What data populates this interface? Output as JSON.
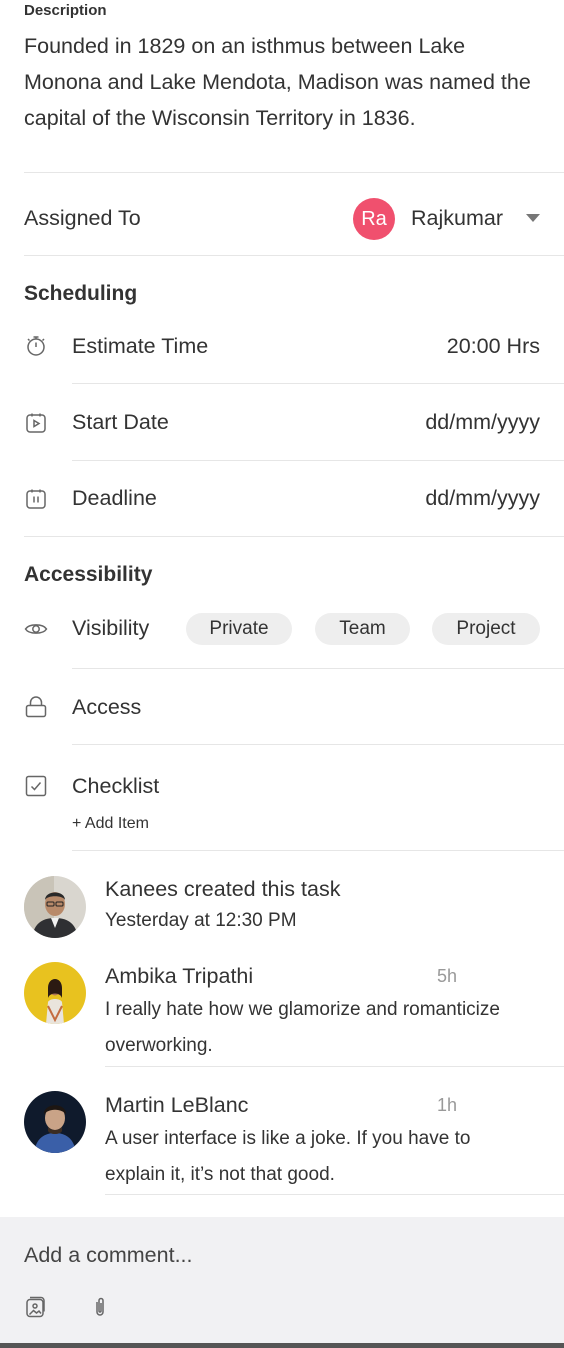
{
  "description": {
    "label": "Description",
    "text": "Founded in 1829 on an isthmus between Lake Monona and Lake Mendota, Madison was named the capital of the Wisconsin Territory in 1836."
  },
  "assigned": {
    "label": "Assigned To",
    "avatar_initials": "Ra",
    "avatar_color": "#f0506e",
    "name": "Rajkumar"
  },
  "scheduling": {
    "title": "Scheduling",
    "estimate": {
      "label": "Estimate Time",
      "value": "20:00 Hrs",
      "icon": "stopwatch-icon"
    },
    "start": {
      "label": "Start Date",
      "value": "dd/mm/yyyy",
      "icon": "calendar-play-icon"
    },
    "deadline": {
      "label": "Deadline",
      "value": "dd/mm/yyyy",
      "icon": "calendar-pause-icon"
    }
  },
  "accessibility": {
    "title": "Accessibility",
    "visibility": {
      "label": "Visibility",
      "icon": "eye-icon",
      "options": [
        "Private",
        "Team",
        "Project"
      ]
    },
    "access": {
      "label": "Access",
      "icon": "lock-icon"
    },
    "checklist": {
      "label": "Checklist",
      "icon": "checkbox-icon",
      "add_item": "+ Add Item"
    }
  },
  "activity": [
    {
      "name": "Kanees created this task",
      "sub": "Yesterday at 12:30 PM"
    },
    {
      "name": "Ambika Tripathi",
      "time": "5h",
      "text": "I really hate how we glamorize and romanticize overworking."
    },
    {
      "name": "Martin LeBlanc",
      "time": "1h",
      "text": "A user interface is like a joke. If you have to explain it, it’s not that good."
    }
  ],
  "comment_bar": {
    "placeholder": "Add a comment...",
    "icons": [
      "image-icon",
      "paperclip-icon"
    ]
  }
}
